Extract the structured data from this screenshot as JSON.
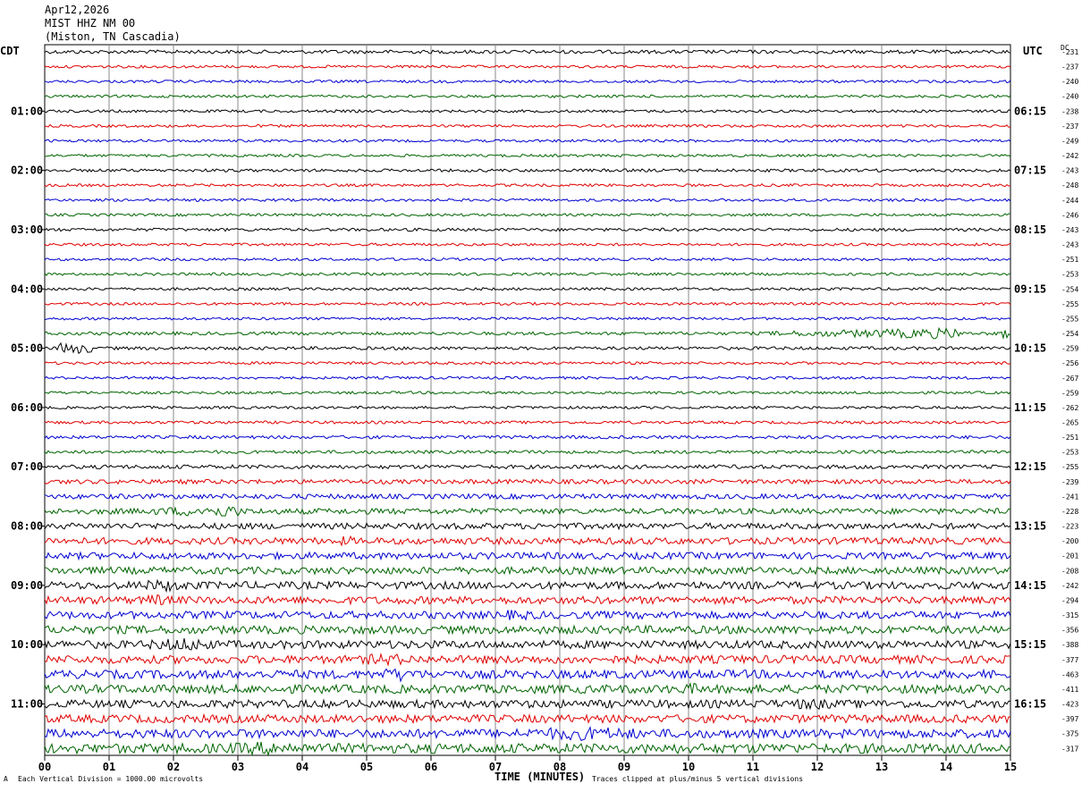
{
  "header": {
    "date": "Apr12,2026",
    "station": "MIST HHZ NM 00",
    "location": "(Miston, TN Cascadia)"
  },
  "left_tz": "CDT",
  "right_tz": "UTC",
  "dc_label": "DC",
  "footer": {
    "mark": "A",
    "scale_note": "Each Vertical Division = 1000.00 microvolts",
    "clip_note": "Traces clipped at plus/minus 5 vertical divisions"
  },
  "colors": {
    "trace_cycle": [
      "#000000",
      "#e00000",
      "#0000d0",
      "#006400"
    ],
    "grid": "#888888"
  },
  "chart_data": {
    "type": "line",
    "title": "",
    "xlabel": "TIME (MINUTES)",
    "xlim": [
      0,
      15
    ],
    "x_ticks": [
      "00",
      "01",
      "02",
      "03",
      "04",
      "05",
      "06",
      "07",
      "08",
      "09",
      "10",
      "11",
      "12",
      "13",
      "14",
      "15"
    ],
    "row_count": 48,
    "rows_per_hour": 4,
    "left_hour_labels": [
      "01:00",
      "02:00",
      "03:00",
      "04:00",
      "05:00",
      "06:00",
      "07:00",
      "08:00",
      "09:00",
      "10:00",
      "11:00"
    ],
    "right_hour_labels": [
      "06:15",
      "07:15",
      "08:15",
      "09:15",
      "10:15",
      "11:15",
      "12:15",
      "13:15",
      "14:15",
      "15:15",
      "16:15"
    ],
    "dc_offsets": [
      "-231",
      "-237",
      "-240",
      "-240",
      "-238",
      "-237",
      "-249",
      "-242",
      "-243",
      "-248",
      "-244",
      "-246",
      "-243",
      "-243",
      "-251",
      "-253",
      "-254",
      "-255",
      "-255",
      "-254",
      "-259",
      "-256",
      "-267",
      "-259",
      "-262",
      "-265",
      "-251",
      "-253",
      "-255",
      "-239",
      "-241",
      "-228",
      "-223",
      "-200",
      "-201",
      "-208",
      "-242",
      "-294",
      "-315",
      "-356",
      "-388",
      "-377",
      "-463",
      "-411",
      "-423",
      "-397",
      "-375",
      "-317"
    ],
    "noise_amplitude": [
      2.0,
      1.5,
      1.5,
      1.5,
      1.5,
      1.5,
      1.5,
      1.5,
      1.7,
      1.5,
      1.5,
      1.5,
      1.7,
      1.5,
      1.5,
      1.5,
      1.5,
      1.5,
      1.5,
      1.8,
      1.8,
      1.5,
      1.5,
      1.5,
      1.5,
      1.6,
      1.8,
      1.8,
      2.2,
      2.5,
      2.8,
      3.2,
      3.4,
      3.8,
      3.8,
      4.0,
      4.2,
      4.2,
      4.2,
      4.5,
      4.5,
      4.5,
      4.8,
      4.8,
      4.5,
      4.5,
      5.0,
      5.5
    ],
    "events": [
      {
        "row": 19,
        "start_min": 11.2,
        "end_min": 14.2,
        "peak_min": 14.0,
        "amp": 6
      },
      {
        "row": 19,
        "start_min": 14.8,
        "end_min": 15.0,
        "peak_min": 14.9,
        "amp": 6
      },
      {
        "row": 20,
        "start_min": 0.2,
        "end_min": 0.8,
        "peak_min": 0.4,
        "amp": 7
      },
      {
        "row": 29,
        "start_min": 7.8,
        "end_min": 7.9,
        "peak_min": 7.85,
        "amp": 4
      },
      {
        "row": 31,
        "start_min": 1.2,
        "end_min": 3.0,
        "peak_min": 2.9,
        "amp": 7
      },
      {
        "row": 33,
        "start_min": 4.5,
        "end_min": 4.8,
        "peak_min": 4.7,
        "amp": 6
      },
      {
        "row": 36,
        "start_min": 1.2,
        "end_min": 2.2,
        "peak_min": 1.9,
        "amp": 7
      },
      {
        "row": 37,
        "start_min": 1.5,
        "end_min": 2.0,
        "peak_min": 1.7,
        "amp": 7
      },
      {
        "row": 38,
        "start_min": 7.0,
        "end_min": 8.0,
        "peak_min": 7.3,
        "amp": 6
      },
      {
        "row": 40,
        "start_min": 1.6,
        "end_min": 2.6,
        "peak_min": 2.2,
        "amp": 8
      },
      {
        "row": 41,
        "start_min": 5.0,
        "end_min": 6.0,
        "peak_min": 5.3,
        "amp": 7
      },
      {
        "row": 42,
        "start_min": 5.2,
        "end_min": 5.8,
        "peak_min": 5.5,
        "amp": 8
      },
      {
        "row": 43,
        "start_min": 9.8,
        "end_min": 10.4,
        "peak_min": 10.0,
        "amp": 7
      },
      {
        "row": 44,
        "start_min": 11.5,
        "end_min": 12.2,
        "peak_min": 11.9,
        "amp": 7
      },
      {
        "row": 46,
        "start_min": 7.2,
        "end_min": 9.2,
        "peak_min": 8.4,
        "amp": 8
      },
      {
        "row": 47,
        "start_min": 2.5,
        "end_min": 4.0,
        "peak_min": 3.5,
        "amp": 8
      }
    ]
  }
}
